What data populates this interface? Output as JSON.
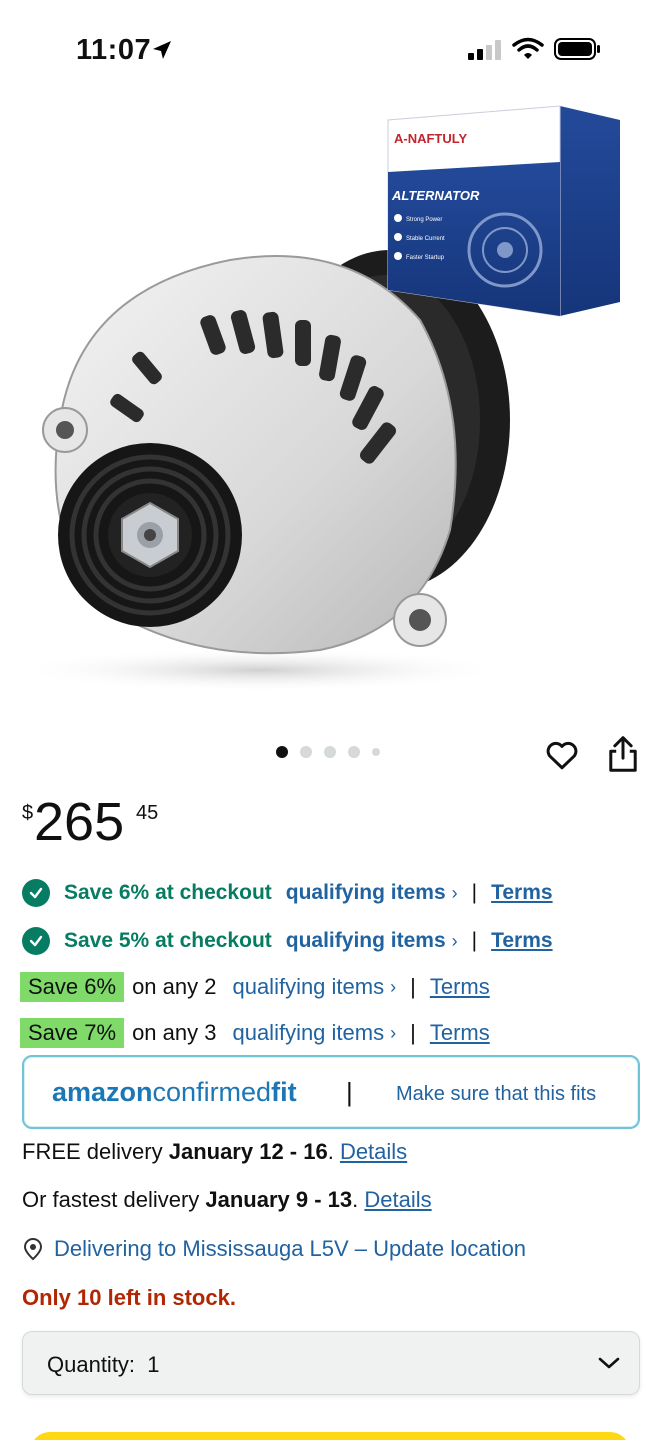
{
  "status_bar": {
    "time": "11:07"
  },
  "carousel": {
    "dot_count": 5,
    "active_index": 0
  },
  "price": {
    "symbol": "$",
    "whole": "265",
    "fraction": "45"
  },
  "promos": [
    {
      "type": "checkout",
      "text": "Save 6% at checkout",
      "link": "qualifying items",
      "terms": "Terms"
    },
    {
      "type": "checkout",
      "text": "Save 5% at checkout",
      "link": "qualifying items",
      "terms": "Terms"
    },
    {
      "type": "multi",
      "badge": "Save 6%",
      "text": "on any 2",
      "link": "qualifying items",
      "terms": "Terms"
    },
    {
      "type": "multi",
      "badge": "Save 7%",
      "text": "on any 3",
      "link": "qualifying items",
      "terms": "Terms"
    }
  ],
  "confirmed_fit": {
    "logo_part1": "amazon",
    "logo_part2": "confirmed",
    "logo_part3": "fit",
    "separator": "|",
    "link": "Make sure that this fits"
  },
  "delivery": {
    "free_prefix": "FREE delivery ",
    "free_dates": "January 12 - 16",
    "free_suffix": ". ",
    "free_link": "Details",
    "fast_prefix": "Or fastest delivery ",
    "fast_dates": "January 9 - 13",
    "fast_suffix": ". ",
    "fast_link": "Details",
    "location": "Delivering to Mississauga L5V – Update location"
  },
  "stock": "Only 10 left in stock.",
  "quantity": {
    "label": "Quantity:",
    "value": "1"
  },
  "colors": {
    "link": "#2162a1",
    "deal_green": "#067d62",
    "badge_green": "#7fda69",
    "stock_red": "#b12704",
    "add_to_cart": "#ffd814"
  },
  "product_box": {
    "brand": "A-NAFTULY",
    "title": "ALTERNATOR",
    "features": [
      "Strong Power",
      "Stable Current",
      "Faster Startup"
    ]
  },
  "icons": [
    "location-arrow-icon",
    "signal-icon",
    "wifi-icon",
    "battery-icon",
    "heart-icon",
    "share-icon",
    "check-icon",
    "chevron-right-icon",
    "location-pin-icon",
    "chevron-down-icon"
  ]
}
